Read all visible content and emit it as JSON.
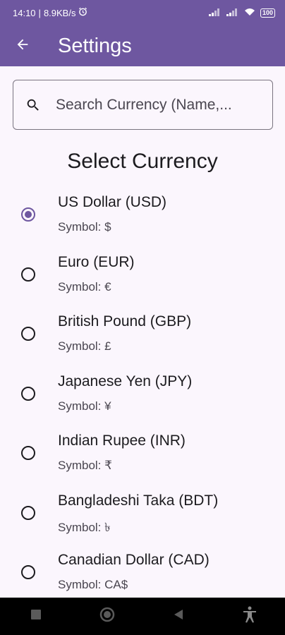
{
  "status_bar": {
    "time": "14:10",
    "speed": "8.9KB/s",
    "battery": "100"
  },
  "app_bar": {
    "title": "Settings",
    "back_icon": "arrow-left-icon"
  },
  "search": {
    "placeholder": "Search Currency (Name,...",
    "value": "",
    "icon": "search-icon"
  },
  "section_title": "Select Currency",
  "currencies": [
    {
      "name": "US Dollar (USD)",
      "symbol": "Symbol: $",
      "selected": true
    },
    {
      "name": "Euro (EUR)",
      "symbol": "Symbol: €",
      "selected": false
    },
    {
      "name": "British Pound (GBP)",
      "symbol": "Symbol: £",
      "selected": false
    },
    {
      "name": "Japanese Yen (JPY)",
      "symbol": "Symbol: ¥",
      "selected": false
    },
    {
      "name": "Indian Rupee (INR)",
      "symbol": "Symbol: ₹",
      "selected": false
    },
    {
      "name": "Bangladeshi Taka (BDT)",
      "symbol": "Symbol: ৳",
      "selected": false
    },
    {
      "name": "Canadian Dollar (CAD)",
      "symbol": "Symbol: CA$",
      "selected": false
    }
  ],
  "colors": {
    "primary": "#6e57a0",
    "background": "#fbf6fd",
    "nav_bar": "#000000"
  }
}
